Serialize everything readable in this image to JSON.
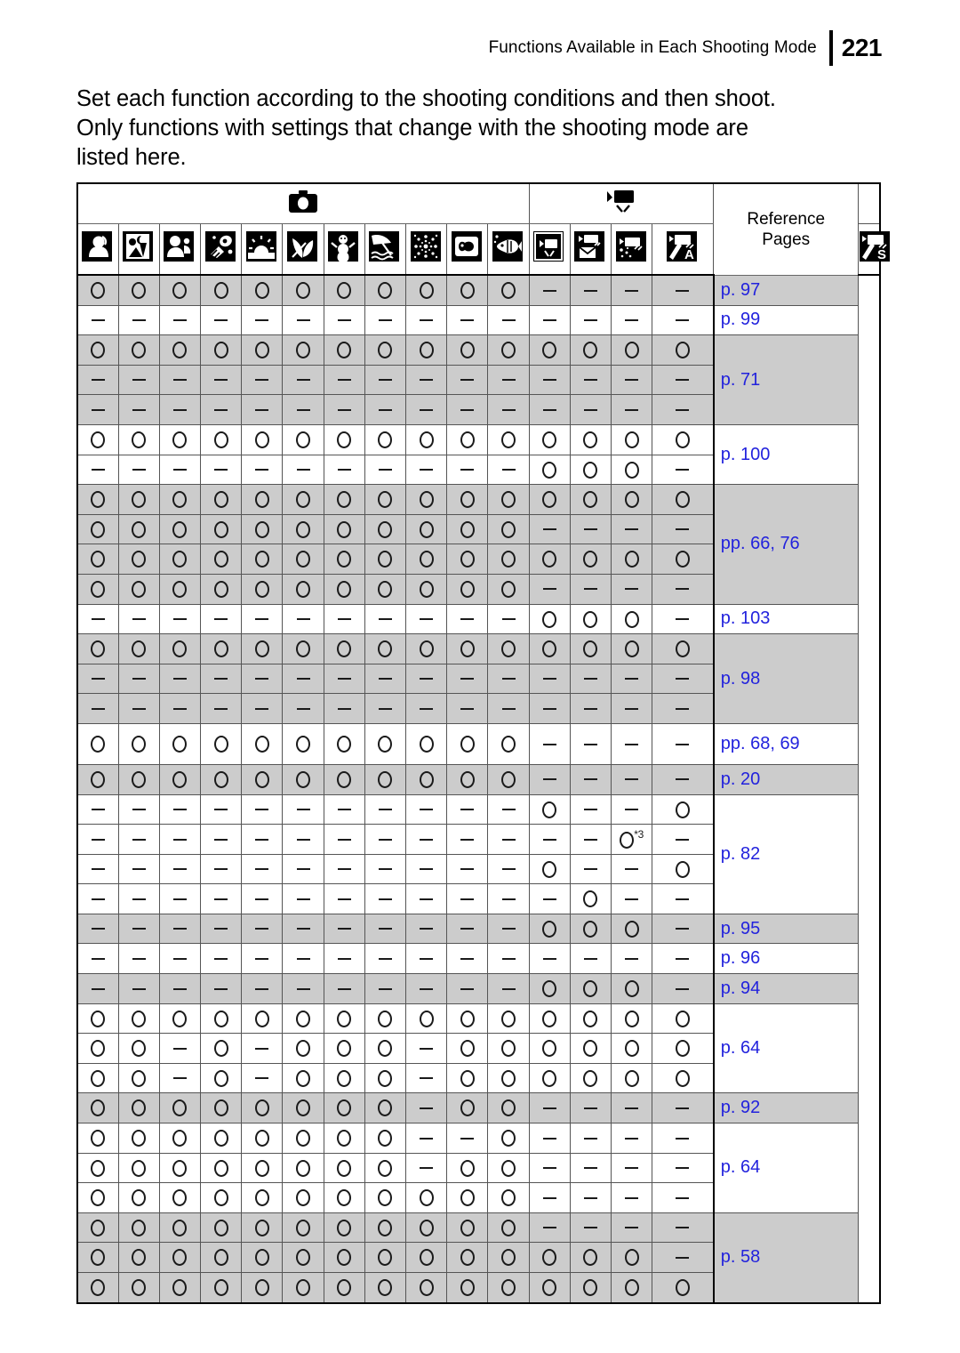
{
  "header": {
    "title": "Functions Available in Each Shooting Mode",
    "page_number": "221"
  },
  "intro": {
    "line1": "Set each function according to the shooting conditions and then shoot.",
    "line2": "Only functions with settings that change with the shooting mode are",
    "line3": "listed here."
  },
  "table": {
    "group_headers": [
      {
        "id": "still",
        "icon": "camera-icon",
        "colspan": 11
      },
      {
        "id": "movie",
        "icon": "movie-camera-icon",
        "colspan": 4
      },
      {
        "id": "reference",
        "label": "Reference\nPages",
        "label_line1": "Reference",
        "label_line2": "Pages"
      }
    ],
    "columns": [
      {
        "index": 0,
        "group": "still",
        "icon": "portrait-icon"
      },
      {
        "index": 1,
        "group": "still",
        "icon": "night-snapshot-icon"
      },
      {
        "index": 2,
        "group": "still",
        "icon": "kids-and-pets-icon"
      },
      {
        "index": 3,
        "group": "still",
        "icon": "indoor-icon"
      },
      {
        "index": 4,
        "group": "still",
        "icon": "sunset-icon"
      },
      {
        "index": 5,
        "group": "still",
        "icon": "foliage-icon"
      },
      {
        "index": 6,
        "group": "still",
        "icon": "snow-icon"
      },
      {
        "index": 7,
        "group": "still",
        "icon": "beach-icon"
      },
      {
        "index": 8,
        "group": "still",
        "icon": "fireworks-icon"
      },
      {
        "index": 9,
        "group": "still",
        "icon": "aquarium-icon"
      },
      {
        "index": 10,
        "group": "still",
        "icon": "underwater-icon"
      },
      {
        "index": 11,
        "group": "movie",
        "icon": "movie-standard-icon"
      },
      {
        "index": 12,
        "group": "movie",
        "icon": "movie-compact-icon"
      },
      {
        "index": 13,
        "group": "movie",
        "icon": "movie-color-accent-swap-icon"
      },
      {
        "index": 14,
        "group": "movie",
        "icon": "movie-color-accent-a-icon"
      },
      {
        "index": 15,
        "group": "movie",
        "icon": "movie-color-swap-s-icon"
      }
    ],
    "column_spans": {
      "note": "last movie column cell spans the final two icon columns in body rows",
      "body_cell_count": 15
    },
    "rows": [
      {
        "i": 0,
        "shade": true,
        "cells": [
          "O",
          "O",
          "O",
          "O",
          "O",
          "O",
          "O",
          "O",
          "O",
          "O",
          "O",
          "-",
          "-",
          "-",
          "-"
        ],
        "ref": "p. 97",
        "ref_rowspan": 1
      },
      {
        "i": 1,
        "shade": false,
        "cells": [
          "-",
          "-",
          "-",
          "-",
          "-",
          "-",
          "-",
          "-",
          "-",
          "-",
          "-",
          "-",
          "-",
          "-",
          "-"
        ],
        "ref": "p. 99",
        "ref_rowspan": 1
      },
      {
        "i": 2,
        "shade": true,
        "cells": [
          "O",
          "O",
          "O",
          "O",
          "O",
          "O",
          "O",
          "O",
          "O",
          "O",
          "O",
          "O",
          "O",
          "O",
          "O"
        ],
        "ref": "p. 71",
        "ref_rowspan": 3
      },
      {
        "i": 3,
        "shade": true,
        "cells": [
          "-",
          "-",
          "-",
          "-",
          "-",
          "-",
          "-",
          "-",
          "-",
          "-",
          "-",
          "-",
          "-",
          "-",
          "-"
        ],
        "ref": null
      },
      {
        "i": 4,
        "shade": true,
        "cells": [
          "-",
          "-",
          "-",
          "-",
          "-",
          "-",
          "-",
          "-",
          "-",
          "-",
          "-",
          "-",
          "-",
          "-",
          "-"
        ],
        "ref": null
      },
      {
        "i": 5,
        "shade": false,
        "cells": [
          "O",
          "O",
          "O",
          "O",
          "O",
          "O",
          "O",
          "O",
          "O",
          "O",
          "O",
          "O",
          "O",
          "O",
          "O"
        ],
        "ref": "p. 100",
        "ref_rowspan": 2
      },
      {
        "i": 6,
        "shade": false,
        "cells": [
          "-",
          "-",
          "-",
          "-",
          "-",
          "-",
          "-",
          "-",
          "-",
          "-",
          "-",
          "O",
          "O",
          "O",
          "-"
        ],
        "ref": null
      },
      {
        "i": 7,
        "shade": true,
        "cells": [
          "O",
          "O",
          "O",
          "O",
          "O",
          "O",
          "O",
          "O",
          "O",
          "O",
          "O",
          "O",
          "O",
          "O",
          "O"
        ],
        "ref": "pp. 66, 76",
        "ref_rowspan": 4
      },
      {
        "i": 8,
        "shade": true,
        "cells": [
          "O",
          "O",
          "O",
          "O",
          "O",
          "O",
          "O",
          "O",
          "O",
          "O",
          "O",
          "-",
          "-",
          "-",
          "-"
        ],
        "ref": null
      },
      {
        "i": 9,
        "shade": true,
        "cells": [
          "O",
          "O",
          "O",
          "O",
          "O",
          "O",
          "O",
          "O",
          "O",
          "O",
          "O",
          "O",
          "O",
          "O",
          "O"
        ],
        "ref": null
      },
      {
        "i": 10,
        "shade": true,
        "cells": [
          "O",
          "O",
          "O",
          "O",
          "O",
          "O",
          "O",
          "O",
          "O",
          "O",
          "O",
          "-",
          "-",
          "-",
          "-"
        ],
        "ref": null
      },
      {
        "i": 11,
        "shade": false,
        "cells": [
          "-",
          "-",
          "-",
          "-",
          "-",
          "-",
          "-",
          "-",
          "-",
          "-",
          "-",
          "O",
          "O",
          "O",
          "-"
        ],
        "ref": "p. 103",
        "ref_rowspan": 1
      },
      {
        "i": 12,
        "shade": true,
        "cells": [
          "O",
          "O",
          "O",
          "O",
          "O",
          "O",
          "O",
          "O",
          "O",
          "O",
          "O",
          "O",
          "O",
          "O",
          "O"
        ],
        "ref": "p. 98",
        "ref_rowspan": 3
      },
      {
        "i": 13,
        "shade": true,
        "cells": [
          "-",
          "-",
          "-",
          "-",
          "-",
          "-",
          "-",
          "-",
          "-",
          "-",
          "-",
          "-",
          "-",
          "-",
          "-"
        ],
        "ref": null
      },
      {
        "i": 14,
        "shade": true,
        "cells": [
          "-",
          "-",
          "-",
          "-",
          "-",
          "-",
          "-",
          "-",
          "-",
          "-",
          "-",
          "-",
          "-",
          "-",
          "-"
        ],
        "ref": null
      },
      {
        "i": 15,
        "shade": false,
        "cells": [
          "O",
          "O",
          "O",
          "O",
          "O",
          "O",
          "O",
          "O",
          "O",
          "O",
          "O",
          "-",
          "-",
          "-",
          "-"
        ],
        "ref": "pp. 68, 69",
        "ref_rowspan": 1,
        "tall": true
      },
      {
        "i": 16,
        "shade": true,
        "cells": [
          "O",
          "O",
          "O",
          "O",
          "O",
          "O",
          "O",
          "O",
          "O",
          "O",
          "O",
          "-",
          "-",
          "-",
          "-"
        ],
        "ref": "p. 20",
        "ref_rowspan": 1
      },
      {
        "i": 17,
        "shade": false,
        "cells": [
          "-",
          "-",
          "-",
          "-",
          "-",
          "-",
          "-",
          "-",
          "-",
          "-",
          "-",
          "O",
          "-",
          "-",
          "O"
        ],
        "ref": "p. 82",
        "ref_rowspan": 4
      },
      {
        "i": 18,
        "shade": false,
        "cells": [
          "-",
          "-",
          "-",
          "-",
          "-",
          "-",
          "-",
          "-",
          "-",
          "-",
          "-",
          "-",
          "-",
          "O*3",
          "-"
        ],
        "ref": null
      },
      {
        "i": 19,
        "shade": false,
        "cells": [
          "-",
          "-",
          "-",
          "-",
          "-",
          "-",
          "-",
          "-",
          "-",
          "-",
          "-",
          "O",
          "-",
          "-",
          "O"
        ],
        "ref": null
      },
      {
        "i": 20,
        "shade": false,
        "cells": [
          "-",
          "-",
          "-",
          "-",
          "-",
          "-",
          "-",
          "-",
          "-",
          "-",
          "-",
          "-",
          "O",
          "-",
          "-"
        ],
        "ref": null
      },
      {
        "i": 21,
        "shade": true,
        "cells": [
          "-",
          "-",
          "-",
          "-",
          "-",
          "-",
          "-",
          "-",
          "-",
          "-",
          "-",
          "O",
          "O",
          "O",
          "-"
        ],
        "ref": "p. 95",
        "ref_rowspan": 1
      },
      {
        "i": 22,
        "shade": false,
        "cells": [
          "-",
          "-",
          "-",
          "-",
          "-",
          "-",
          "-",
          "-",
          "-",
          "-",
          "-",
          "-",
          "-",
          "-",
          "-"
        ],
        "ref": "p. 96",
        "ref_rowspan": 1
      },
      {
        "i": 23,
        "shade": true,
        "cells": [
          "-",
          "-",
          "-",
          "-",
          "-",
          "-",
          "-",
          "-",
          "-",
          "-",
          "-",
          "O",
          "O",
          "O",
          "-"
        ],
        "ref": "p. 94",
        "ref_rowspan": 1
      },
      {
        "i": 24,
        "shade": false,
        "cells": [
          "O",
          "O",
          "O",
          "O",
          "O",
          "O",
          "O",
          "O",
          "O",
          "O",
          "O",
          "O",
          "O",
          "O",
          "O"
        ],
        "ref": "p. 64",
        "ref_rowspan": 3
      },
      {
        "i": 25,
        "shade": false,
        "cells": [
          "O",
          "O",
          "-",
          "O",
          "-",
          "O",
          "O",
          "O",
          "-",
          "O",
          "O",
          "O",
          "O",
          "O",
          "O"
        ],
        "ref": null
      },
      {
        "i": 26,
        "shade": false,
        "cells": [
          "O",
          "O",
          "-",
          "O",
          "-",
          "O",
          "O",
          "O",
          "-",
          "O",
          "O",
          "O",
          "O",
          "O",
          "O"
        ],
        "ref": null
      },
      {
        "i": 27,
        "shade": true,
        "cells": [
          "O",
          "O",
          "O",
          "O",
          "O",
          "O",
          "O",
          "O",
          "-",
          "O",
          "O",
          "-",
          "-",
          "-",
          "-"
        ],
        "ref": "p. 92",
        "ref_rowspan": 1
      },
      {
        "i": 28,
        "shade": false,
        "cells": [
          "O",
          "O",
          "O",
          "O",
          "O",
          "O",
          "O",
          "O",
          "-",
          "-",
          "O",
          "-",
          "-",
          "-",
          "-"
        ],
        "ref": "p. 64",
        "ref_rowspan": 3
      },
      {
        "i": 29,
        "shade": false,
        "cells": [
          "O",
          "O",
          "O",
          "O",
          "O",
          "O",
          "O",
          "O",
          "-",
          "O",
          "O",
          "-",
          "-",
          "-",
          "-"
        ],
        "ref": null
      },
      {
        "i": 30,
        "shade": false,
        "cells": [
          "O",
          "O",
          "O",
          "O",
          "O",
          "O",
          "O",
          "O",
          "O",
          "O",
          "O",
          "-",
          "-",
          "-",
          "-"
        ],
        "ref": null
      },
      {
        "i": 31,
        "shade": true,
        "cells": [
          "O",
          "O",
          "O",
          "O",
          "O",
          "O",
          "O",
          "O",
          "O",
          "O",
          "O",
          "-",
          "-",
          "-",
          "-"
        ],
        "ref": "p. 58",
        "ref_rowspan": 3
      },
      {
        "i": 32,
        "shade": true,
        "cells": [
          "O",
          "O",
          "O",
          "O",
          "O",
          "O",
          "O",
          "O",
          "O",
          "O",
          "O",
          "O",
          "O",
          "O",
          "-"
        ],
        "ref": null
      },
      {
        "i": 33,
        "shade": true,
        "cells": [
          "O",
          "O",
          "O",
          "O",
          "O",
          "O",
          "O",
          "O",
          "O",
          "O",
          "O",
          "O",
          "O",
          "O",
          "O"
        ],
        "ref": null
      }
    ]
  },
  "legend": {
    "available_symbol": "O",
    "unavailable_symbol": "-",
    "footnote_marker": "*3"
  },
  "colors": {
    "shade_row": "#cccccc",
    "reference_link": "#2222dd",
    "border": "#555555",
    "text": "#000000"
  }
}
